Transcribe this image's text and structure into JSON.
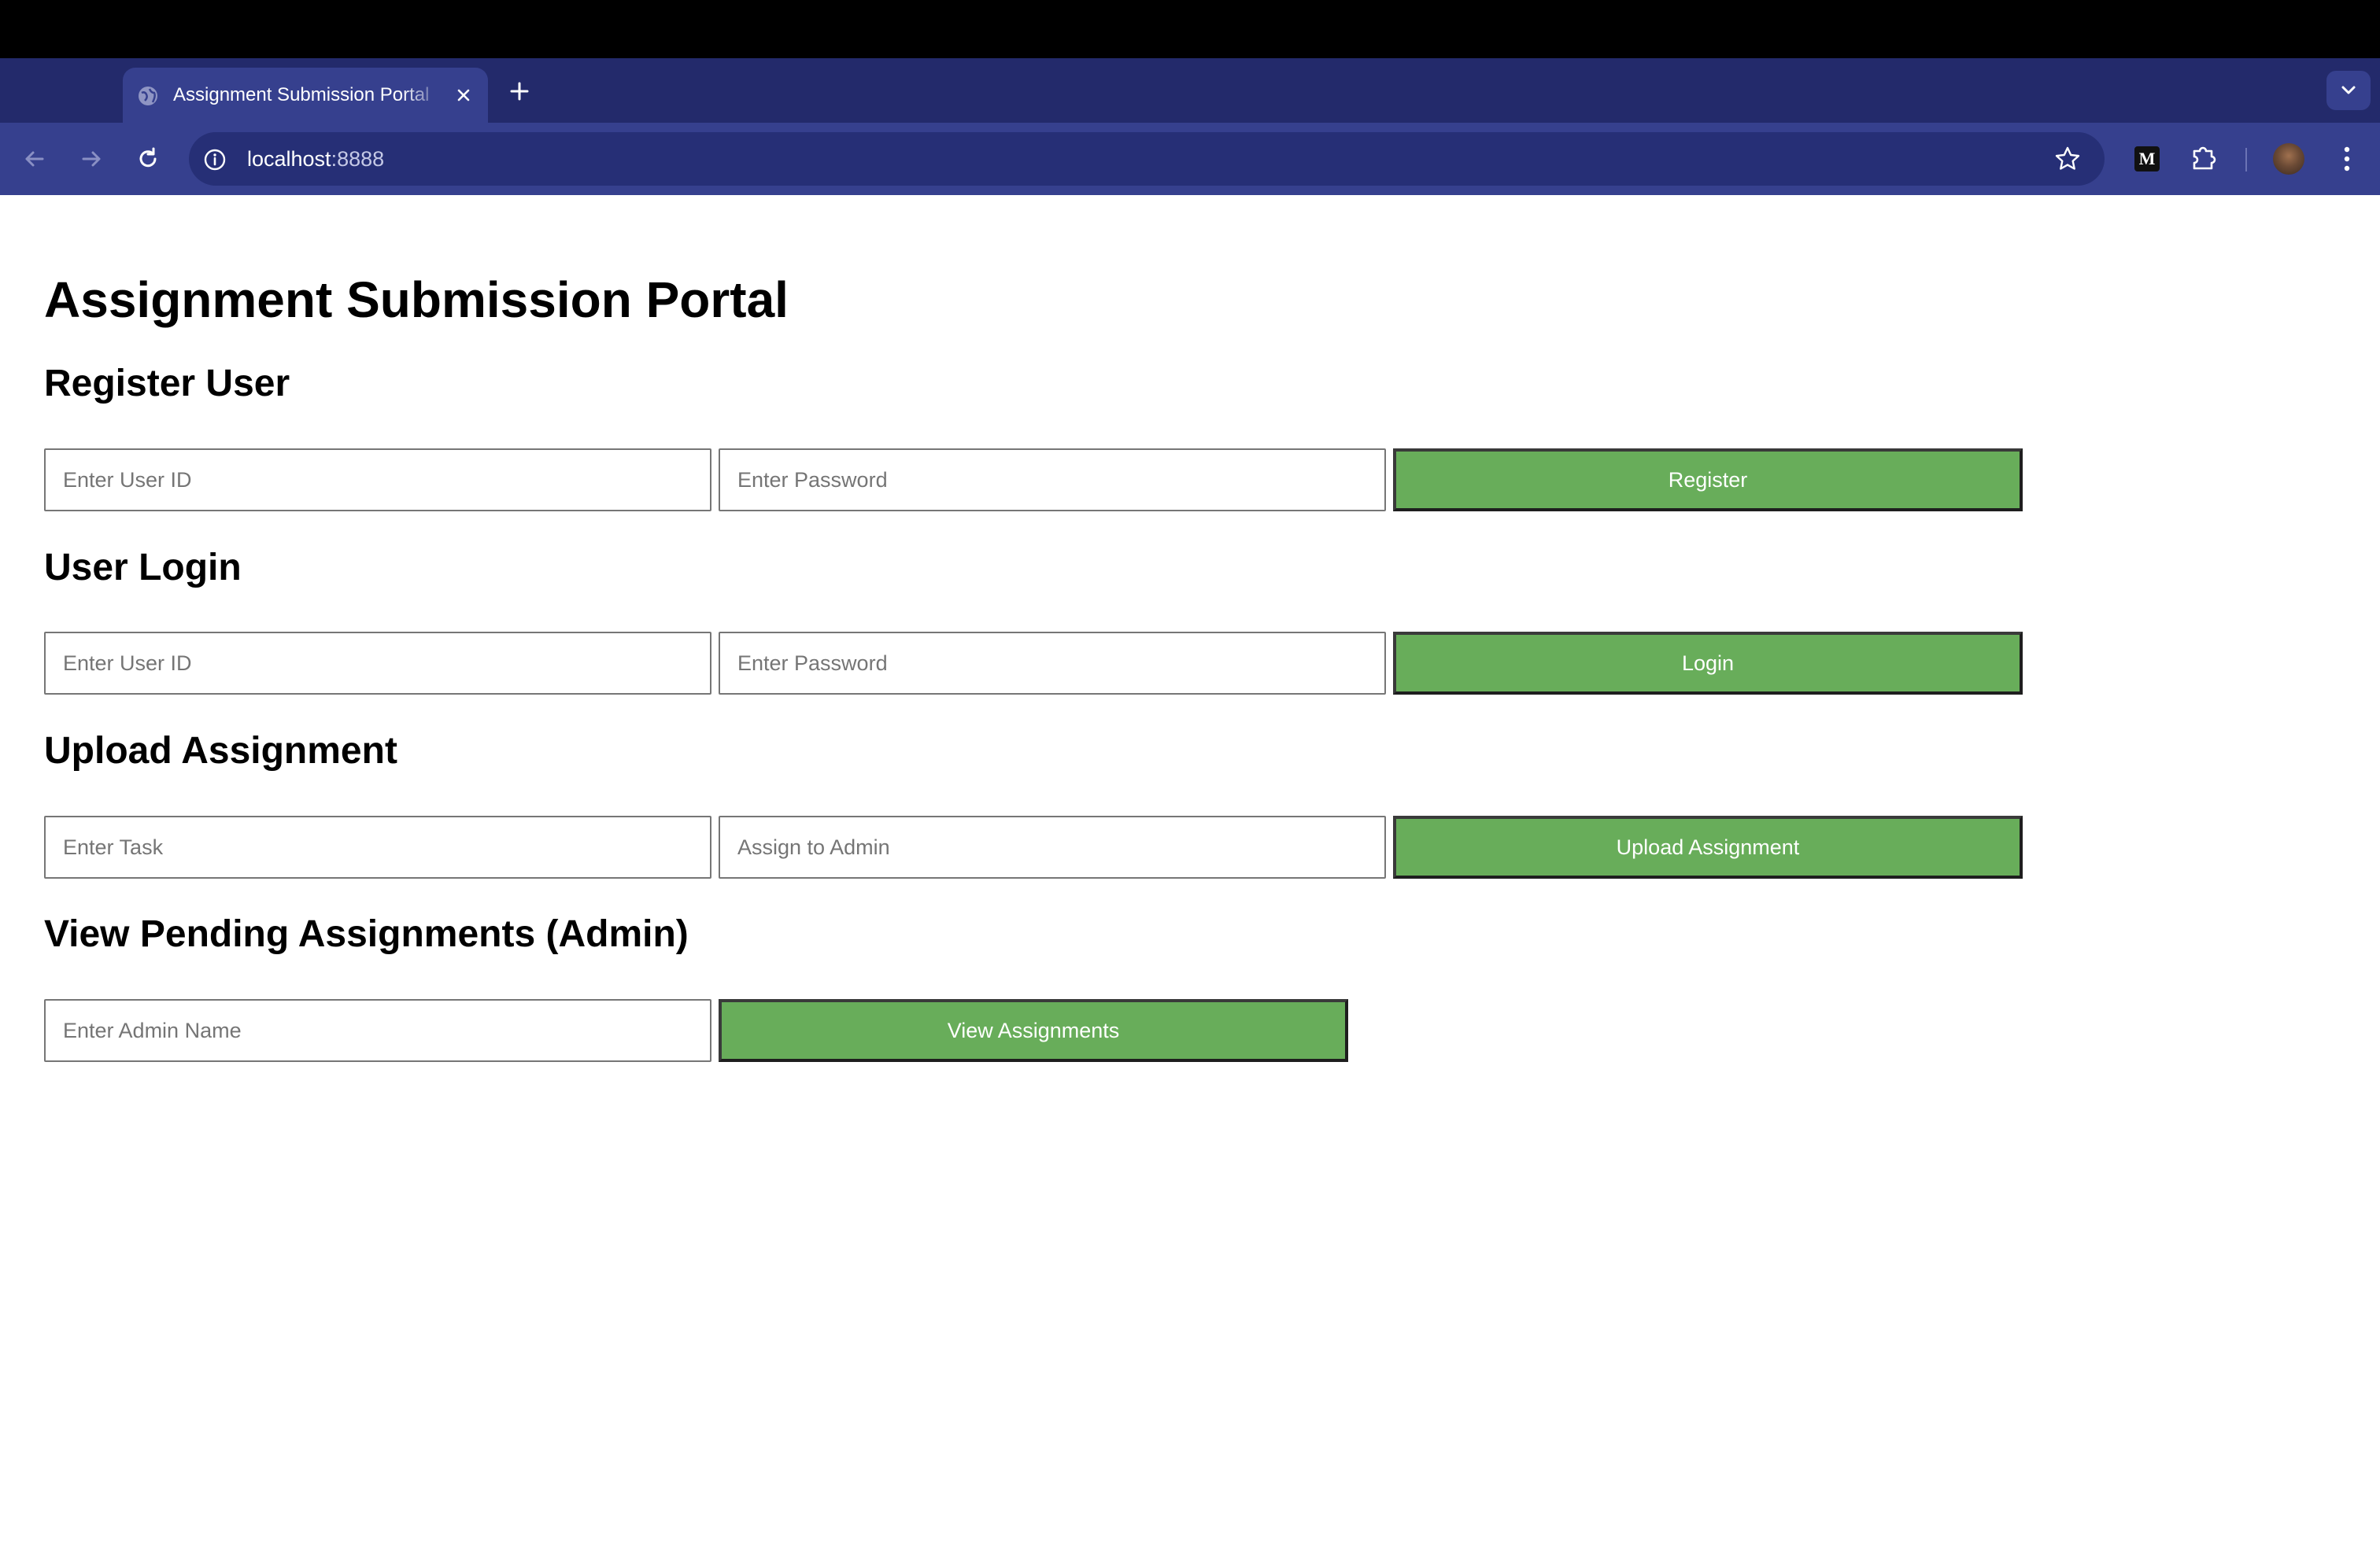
{
  "browser": {
    "tab_title": "Assignment Submission Portal",
    "url_host": "localhost",
    "url_port": ":8888",
    "extension_label": "M"
  },
  "page": {
    "title": "Assignment Submission Portal",
    "register": {
      "heading": "Register User",
      "user_id_placeholder": "Enter User ID",
      "password_placeholder": "Enter Password",
      "button_label": "Register"
    },
    "login": {
      "heading": "User Login",
      "user_id_placeholder": "Enter User ID",
      "password_placeholder": "Enter Password",
      "button_label": "Login"
    },
    "upload": {
      "heading": "Upload Assignment",
      "task_placeholder": "Enter Task",
      "admin_placeholder": "Assign to Admin",
      "button_label": "Upload Assignment"
    },
    "view": {
      "heading": "View Pending Assignments (Admin)",
      "admin_name_placeholder": "Enter Admin Name",
      "button_label": "View Assignments"
    }
  },
  "colors": {
    "tabstrip": "#232a6b",
    "toolbar": "#36408e",
    "button_green": "#68ad5a"
  }
}
